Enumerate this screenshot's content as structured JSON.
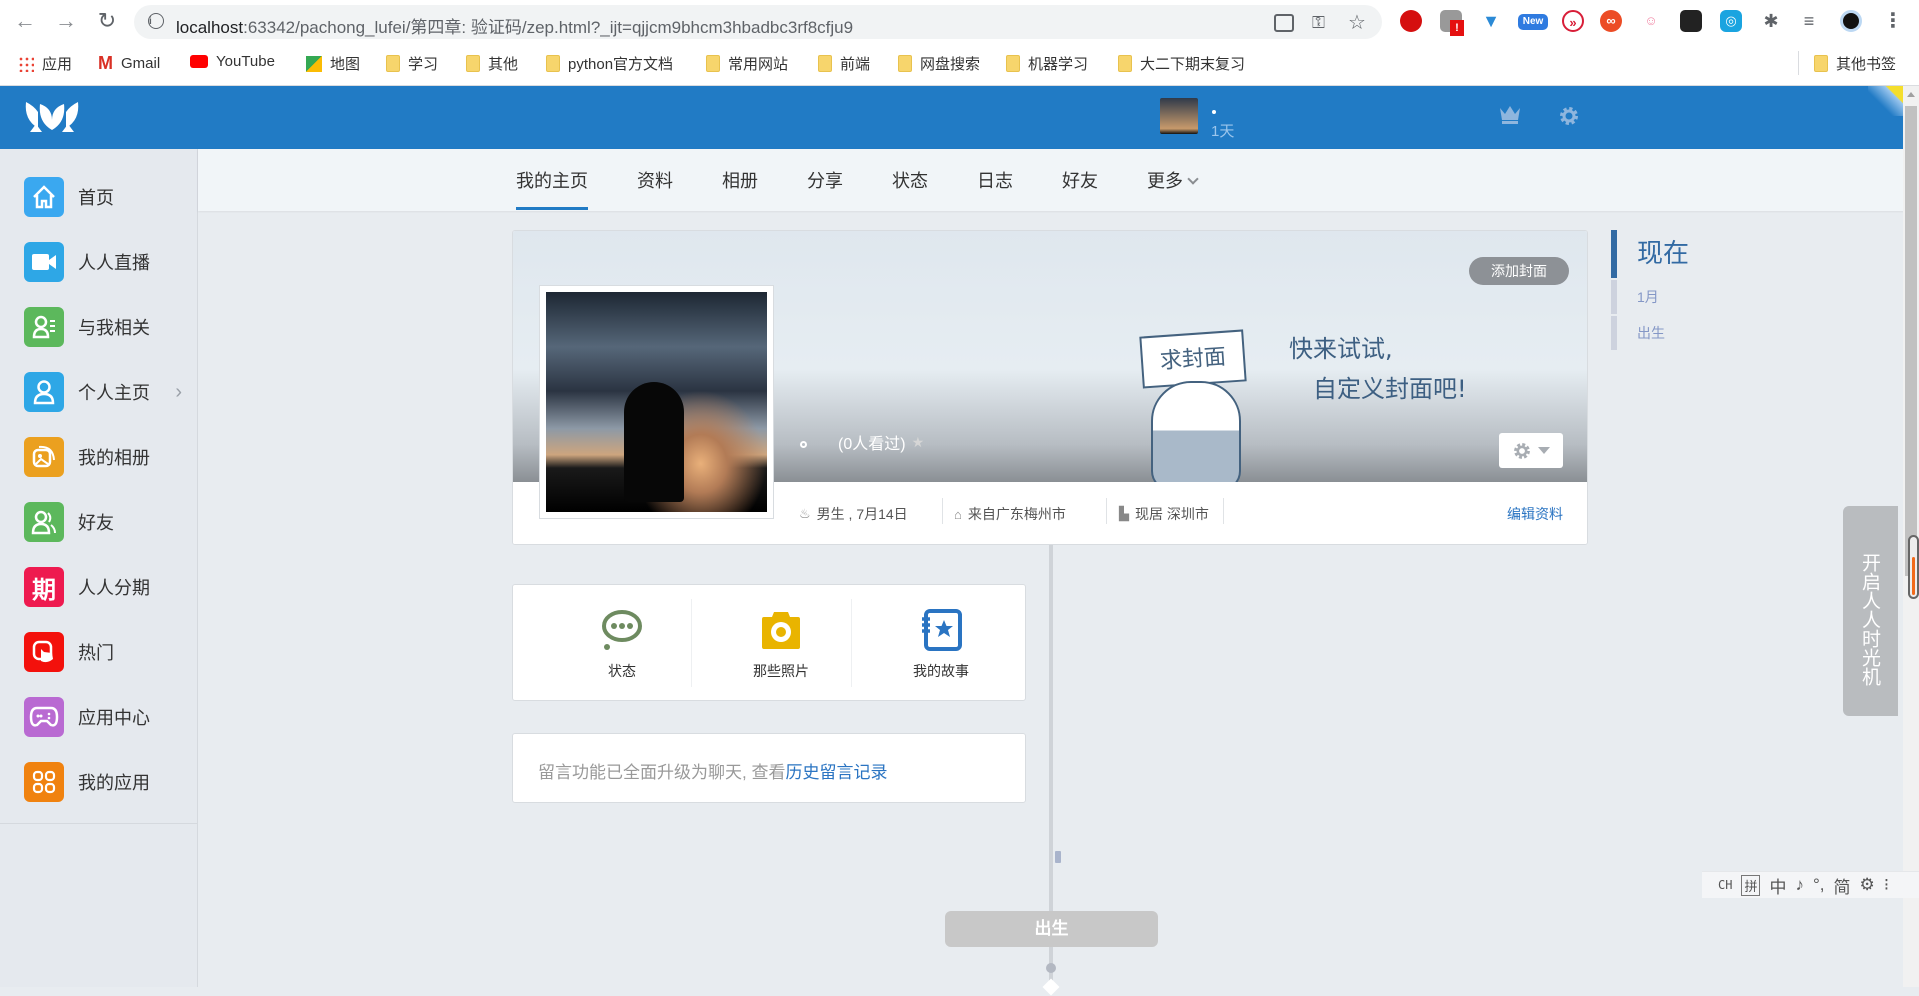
{
  "browser": {
    "url_host": "localhost",
    "url_rest": ":63342/pachong_lufei/第四章: 验证码/zep.html?_ijt=qjjcm9bhcm3hbadbc3rf8cfju9",
    "back_icon": "←",
    "forward_icon": "→",
    "reload_icon": "↻",
    "info_icon": "i",
    "key_icon": "⚿",
    "star_icon": "☆",
    "extensions": [
      "stop",
      "!",
      "▼",
      "New",
      "»",
      "∞",
      "☺",
      "◙",
      "◎",
      "✱",
      "≡",
      "●",
      "⋮"
    ],
    "bookmarks": [
      {
        "label": "应用",
        "icon": "apps-grid"
      },
      {
        "label": "Gmail",
        "icon": "gmail"
      },
      {
        "label": "YouTube",
        "icon": "youtube"
      },
      {
        "label": "地图",
        "icon": "maps"
      },
      {
        "label": "学习",
        "icon": "folder"
      },
      {
        "label": "其他",
        "icon": "folder"
      },
      {
        "label": "python官方文档",
        "icon": "folder"
      },
      {
        "label": "常用网站",
        "icon": "folder"
      },
      {
        "label": "前端",
        "icon": "folder"
      },
      {
        "label": "网盘搜索",
        "icon": "folder"
      },
      {
        "label": "机器学习",
        "icon": "folder"
      },
      {
        "label": "大二下期末复习",
        "icon": "folder"
      }
    ],
    "other_bookmarks": "其他书签"
  },
  "header": {
    "days": "1天",
    "brand_color": "#217bc5"
  },
  "sidebar": {
    "items": [
      {
        "label": "首页",
        "color": "#3aa8f0",
        "glyph": "⌂"
      },
      {
        "label": "人人直播",
        "color": "#2ea7e6",
        "glyph": "■"
      },
      {
        "label": "与我相关",
        "color": "#5cb85c",
        "glyph": "☰"
      },
      {
        "label": "个人主页",
        "color": "#2ea7e6",
        "glyph": "☺",
        "chevron": "›"
      },
      {
        "label": "我的相册",
        "color": "#eba01f",
        "glyph": "▣"
      },
      {
        "label": "好友",
        "color": "#5cb85c",
        "glyph": "☺"
      },
      {
        "label": "人人分期",
        "color": "#ee1a4f",
        "glyph": "期"
      },
      {
        "label": "热门",
        "color": "#f3110c",
        "glyph": "☝"
      },
      {
        "label": "应用中心",
        "color": "#b96ad2",
        "glyph": "◎"
      },
      {
        "label": "我的应用",
        "color": "#f0820f",
        "glyph": "✿"
      }
    ]
  },
  "tabs": [
    {
      "label": "我的主页",
      "active": true
    },
    {
      "label": "资料"
    },
    {
      "label": "相册"
    },
    {
      "label": "分享"
    },
    {
      "label": "状态"
    },
    {
      "label": "日志"
    },
    {
      "label": "好友"
    },
    {
      "label": "更多"
    }
  ],
  "cover": {
    "add_cover": "添加封面",
    "sign_text": "求封面",
    "slogan_line1": "快来试试,",
    "slogan_line2": "自定义封面吧!",
    "views": "(0人看过)",
    "star_icon": "★",
    "gear_icon": "⚙"
  },
  "profile_info": {
    "gender_birthday": "男生 , 7月14日",
    "hometown": "来自广东梅州市",
    "residence": "现居 深圳市",
    "edit_link": "编辑资料"
  },
  "quick_actions": [
    {
      "label": "状态",
      "icon": "speech-bubble-icon",
      "color": "#6e8b60"
    },
    {
      "label": "那些照片",
      "icon": "camera-icon",
      "color": "#e9b400"
    },
    {
      "label": "我的故事",
      "icon": "story-book-icon",
      "color": "#2a74c2"
    }
  ],
  "message_board": {
    "text": "留言功能已全面升级为聊天, 查看",
    "link": "历史留言记录"
  },
  "timeline_nav": {
    "now": "现在",
    "items": [
      "1月",
      "出生"
    ]
  },
  "timeline": {
    "birth_label": "出生"
  },
  "time_machine": "开启人人时光机",
  "ime": {
    "items": [
      "CH",
      "拼",
      "中",
      "♪",
      "°,",
      "简",
      "⚙",
      "⁝"
    ]
  }
}
